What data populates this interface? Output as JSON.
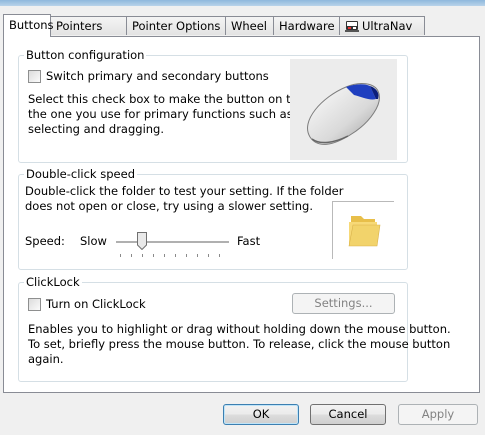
{
  "tabs": [
    {
      "label": "Buttons",
      "active": true
    },
    {
      "label": "Pointers",
      "active": false
    },
    {
      "label": "Pointer Options",
      "active": false
    },
    {
      "label": "Wheel",
      "active": false
    },
    {
      "label": "Hardware",
      "active": false
    },
    {
      "label": "UltraNav",
      "active": false,
      "icon": "ultranav-icon"
    }
  ],
  "button_config": {
    "title": "Button configuration",
    "switch_label": "Switch primary and secondary buttons",
    "switch_checked": false,
    "description": [
      "Select this check box to make the button on the right",
      "the one you use for primary functions such as",
      "selecting and dragging."
    ]
  },
  "double_click": {
    "title": "Double-click speed",
    "description": [
      "Double-click the folder to test your setting. If the folder",
      "does not open or close, try using a slower setting."
    ],
    "speed_label": "Speed:",
    "slow_label": "Slow",
    "fast_label": "Fast",
    "speed_value": 0.2
  },
  "clicklock": {
    "title": "ClickLock",
    "turn_on_label": "Turn on ClickLock",
    "turn_on_checked": false,
    "settings_label": "Settings...",
    "description": [
      "Enables you to highlight or drag without holding down the mouse button.",
      "To set, briefly press the mouse button. To release, click the mouse button",
      "again."
    ]
  },
  "footer": {
    "ok_label": "OK",
    "cancel_label": "Cancel",
    "apply_label": "Apply"
  },
  "colors": {
    "mouse_accent": "#1f3fbf",
    "folder": "#f2d36b"
  }
}
